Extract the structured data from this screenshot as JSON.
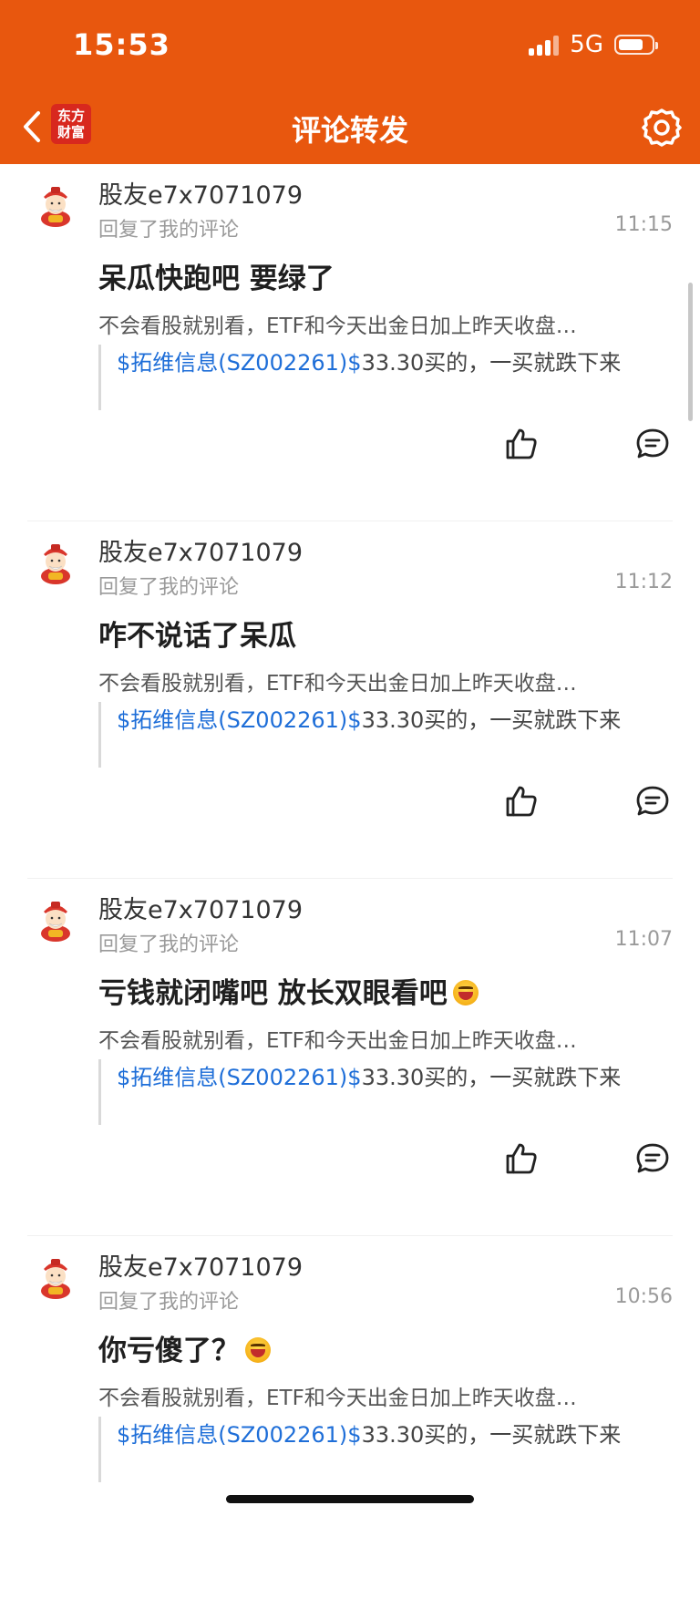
{
  "status_bar": {
    "time": "15:53",
    "network": "5G"
  },
  "navbar": {
    "title": "评论转发",
    "logo_line1": "东方",
    "logo_line2": "财富"
  },
  "items": [
    {
      "username": "股友e7x7071079",
      "subtitle": "回复了我的评论",
      "time": "11:15",
      "reply": "呆瓜快跑吧 要绿了",
      "original": "不会看股就别看，ETF和今天出金日加上昨天收盘…",
      "quote_link": "$拓维信息(SZ002261)$",
      "quote_text": "33.30买的，一买就跌下来"
    },
    {
      "username": "股友e7x7071079",
      "subtitle": "回复了我的评论",
      "time": "11:12",
      "reply": "咋不说话了呆瓜",
      "original": "不会看股就别看，ETF和今天出金日加上昨天收盘…",
      "quote_link": "$拓维信息(SZ002261)$",
      "quote_text": "33.30买的，一买就跌下来"
    },
    {
      "username": "股友e7x7071079",
      "subtitle": "回复了我的评论",
      "time": "11:07",
      "reply": "亏钱就闭嘴吧  放长双眼看吧",
      "original": "不会看股就别看，ETF和今天出金日加上昨天收盘…",
      "quote_link": "$拓维信息(SZ002261)$",
      "quote_text": "33.30买的，一买就跌下来"
    },
    {
      "username": "股友e7x7071079",
      "subtitle": "回复了我的评论",
      "time": "10:56",
      "reply": "你亏傻了？",
      "original": "不会看股就别看，ETF和今天出金日加上昨天收盘…",
      "quote_link": "$拓维信息(SZ002261)$",
      "quote_text": "33.30买的，一买就跌下来"
    }
  ],
  "icons": {
    "back": "chevron-left-icon",
    "settings": "gear-icon",
    "like": "thumbs-up-icon",
    "comment": "comment-bubble-icon",
    "avatar": "fortune-god-avatar"
  },
  "colors": {
    "brand": "#e8570e",
    "link": "#1e6ed8"
  }
}
